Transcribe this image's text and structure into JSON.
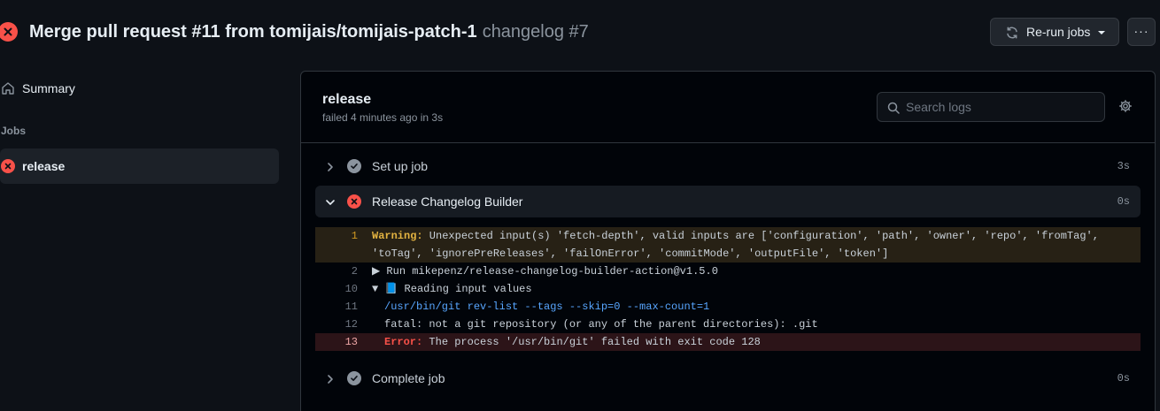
{
  "header": {
    "title": "Merge pull request #11 from tomijais/tomijais-patch-1",
    "subtitle": "changelog #7",
    "rerun_label": "Re-run jobs",
    "more_label": "···"
  },
  "sidebar": {
    "summary_label": "Summary",
    "jobs_heading": "Jobs",
    "job_label": "release"
  },
  "job": {
    "name": "release",
    "meta": "failed 4 minutes ago in 3s",
    "search_placeholder": "Search logs"
  },
  "steps": [
    {
      "label": "Set up job",
      "duration": "3s",
      "status": "success"
    },
    {
      "label": "Release Changelog Builder",
      "duration": "0s",
      "status": "failure"
    },
    {
      "label": "Complete job",
      "duration": "0s",
      "status": "success"
    }
  ],
  "log": [
    {
      "num": "1",
      "prefix": "Warning:",
      "text": " Unexpected input(s) 'fetch-depth', valid inputs are ['configuration', 'path', 'owner', 'repo', 'fromTag', 'toTag', 'ignorePreReleases', 'failOnError', 'commitMode', 'outputFile', 'token']"
    },
    {
      "num": "2",
      "text": "▶ Run mikepenz/release-changelog-builder-action@v1.5.0"
    },
    {
      "num": "10",
      "text": "▼ 📘 Reading input values"
    },
    {
      "num": "11",
      "text": "/usr/bin/git rev-list --tags --skip=0 --max-count=1"
    },
    {
      "num": "12",
      "text": "fatal: not a git repository (or any of the parent directories): .git"
    },
    {
      "num": "13",
      "prefix": "Error:",
      "text": " The process '/usr/bin/git' failed with exit code 128"
    }
  ],
  "colors": {
    "background": "#0d1117",
    "failure": "#f85149",
    "success": "#8b949e",
    "warning": "#d29922",
    "link": "#58a6ff"
  }
}
